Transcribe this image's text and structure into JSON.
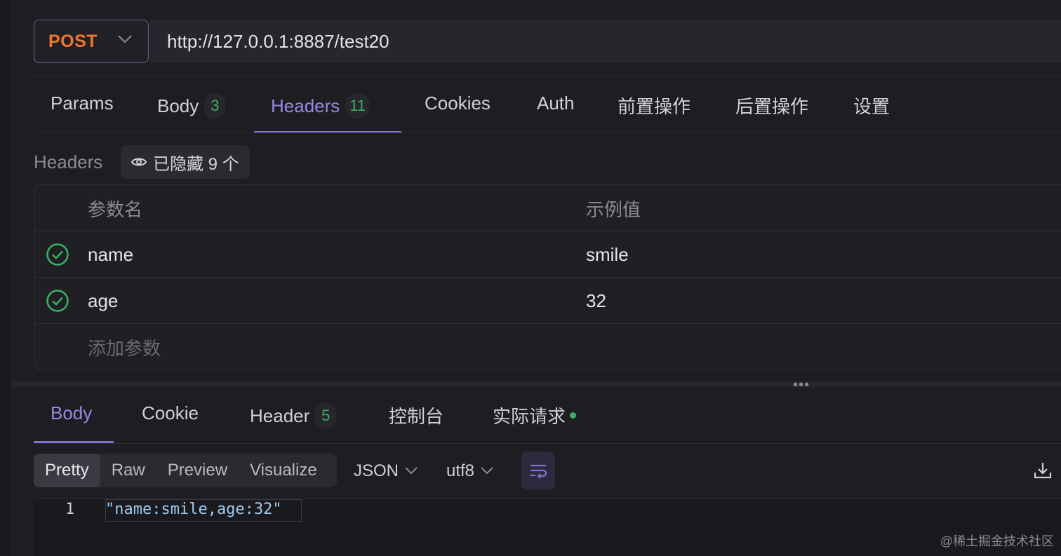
{
  "request": {
    "method": "POST",
    "url": "http://127.0.0.1:8887/test20"
  },
  "tabs": [
    {
      "label": "Params"
    },
    {
      "label": "Body",
      "badge": "3"
    },
    {
      "label": "Headers",
      "badge": "11",
      "active": true
    },
    {
      "label": "Cookies"
    },
    {
      "label": "Auth"
    },
    {
      "label": "前置操作"
    },
    {
      "label": "后置操作"
    },
    {
      "label": "设置"
    }
  ],
  "headers_section": {
    "title": "Headers",
    "hidden_label": "已隐藏 9 个",
    "columns": [
      "参数名",
      "示例值"
    ],
    "rows": [
      {
        "name": "name",
        "value": "smile",
        "enabled": true
      },
      {
        "name": "age",
        "value": "32",
        "enabled": true
      }
    ],
    "add_placeholder": "添加参数"
  },
  "response_tabs": [
    {
      "label": "Body",
      "active": true
    },
    {
      "label": "Cookie"
    },
    {
      "label": "Header",
      "badge": "5"
    },
    {
      "label": "控制台"
    },
    {
      "label": "实际请求",
      "dot": true
    }
  ],
  "response_toolbar": {
    "view_modes": [
      "Pretty",
      "Raw",
      "Preview",
      "Visualize"
    ],
    "selected_mode": "Pretty",
    "format": "JSON",
    "encoding": "utf8"
  },
  "response_body": {
    "line_number": "1",
    "line": "\"name:smile,age:32\""
  },
  "watermark": "@稀土掘金技术社区",
  "colors": {
    "accent": "#8571d6",
    "method": "#f0772f",
    "success": "#39b264"
  }
}
